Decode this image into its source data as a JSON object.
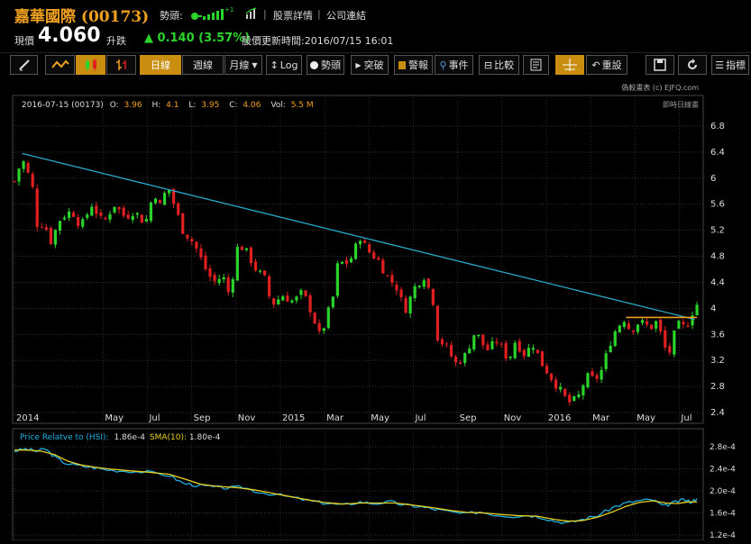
{
  "header": {
    "stock_name": "嘉華國際 (00173)",
    "trend_label": "勢頭:",
    "links": [
      "股票詳情",
      "公司連結"
    ],
    "current_label": "現價",
    "price": "4.060",
    "change_label": "升跌",
    "change": "0.140 (3.57%)",
    "update_label": "股價更新時間:",
    "update_time": "2016/07/15 16:01",
    "signal_text": "+1"
  },
  "toolbar": {
    "daily": "日線",
    "weekly": "週線",
    "monthly": "月線",
    "log": "Log",
    "trend": "勢頭",
    "breakout": "突破",
    "alert": "警報",
    "events": "事件",
    "compare": "比較",
    "reset": "重設",
    "indicators": "指標"
  },
  "colors": {
    "up": "#2bd42b",
    "down": "#e02020",
    "trendline": "#2aa8c8",
    "resistance": "#f0a020",
    "rs_line": "#20b0e0",
    "sma_line": "#e8d020",
    "label_orange": "#f0a020"
  },
  "chart_data": [
    {
      "type": "candlestick",
      "info": {
        "date": "2016-07-15 (00173)",
        "o_label": "O:",
        "o": "3.96",
        "h_label": "H:",
        "h": "4.1",
        "l_label": "L:",
        "l": "3.95",
        "c_label": "C:",
        "c": "4.06",
        "vol_label": "Vol:",
        "vol": "5.5 M"
      },
      "copyright": "偽較畫表 (c) EJFQ.com",
      "sub_label": "即時日線畫",
      "y_ticks": [
        "6.8",
        "6.4",
        "6",
        "5.6",
        "5.2",
        "4.8",
        "4.4",
        "4",
        "3.6",
        "3.2",
        "2.8",
        "2.4"
      ],
      "ylim": [
        2.4,
        6.8
      ],
      "x_ticks": [
        "2014",
        "May",
        "Jul",
        "Sep",
        "Nov",
        "2015",
        "Mar",
        "May",
        "Jul",
        "Sep",
        "Nov",
        "2016",
        "Mar",
        "May",
        "Jul"
      ],
      "x_tick_months": [
        0,
        4,
        6,
        8,
        10,
        12,
        14,
        16,
        18,
        20,
        22,
        24,
        26,
        28,
        30
      ],
      "x_range_months": [
        0,
        31.0
      ],
      "close_anchors": [
        [
          0,
          5.95
        ],
        [
          0.35,
          6.3
        ],
        [
          0.8,
          5.9
        ],
        [
          1.1,
          5.1
        ],
        [
          1.3,
          5.4
        ],
        [
          1.6,
          5.0
        ],
        [
          2.1,
          5.4
        ],
        [
          2.6,
          5.5
        ],
        [
          3.0,
          5.25
        ],
        [
          3.5,
          5.6
        ],
        [
          4.0,
          5.3
        ],
        [
          4.5,
          5.6
        ],
        [
          5.0,
          5.4
        ],
        [
          5.4,
          5.5
        ],
        [
          5.9,
          5.3
        ],
        [
          6.3,
          5.8
        ],
        [
          6.6,
          5.55
        ],
        [
          6.9,
          5.9
        ],
        [
          7.3,
          5.5
        ],
        [
          7.6,
          5.2
        ],
        [
          8.1,
          5.0
        ],
        [
          8.7,
          4.55
        ],
        [
          9.0,
          4.4
        ],
        [
          9.4,
          4.5
        ],
        [
          9.7,
          4.2
        ],
        [
          10.1,
          5.0
        ],
        [
          10.5,
          4.85
        ],
        [
          10.9,
          4.6
        ],
        [
          11.3,
          4.45
        ],
        [
          11.6,
          4.05
        ],
        [
          12.1,
          4.2
        ],
        [
          12.6,
          4.1
        ],
        [
          13.0,
          4.25
        ],
        [
          13.4,
          3.95
        ],
        [
          13.8,
          3.55
        ],
        [
          14.4,
          4.2
        ],
        [
          14.6,
          4.7
        ],
        [
          15.1,
          4.7
        ],
        [
          15.6,
          5.1
        ],
        [
          15.9,
          4.9
        ],
        [
          16.4,
          4.75
        ],
        [
          16.8,
          4.5
        ],
        [
          17.3,
          4.3
        ],
        [
          17.6,
          3.95
        ],
        [
          18.1,
          4.35
        ],
        [
          18.5,
          4.5
        ],
        [
          18.9,
          4.1
        ],
        [
          19.1,
          3.55
        ],
        [
          19.5,
          3.4
        ],
        [
          19.9,
          3.15
        ],
        [
          20.3,
          3.25
        ],
        [
          20.8,
          3.65
        ],
        [
          21.3,
          3.35
        ],
        [
          21.8,
          3.5
        ],
        [
          22.3,
          3.2
        ],
        [
          22.6,
          3.5
        ],
        [
          23.0,
          3.3
        ],
        [
          23.4,
          3.45
        ],
        [
          23.8,
          3.15
        ],
        [
          24.1,
          3.0
        ],
        [
          24.6,
          2.75
        ],
        [
          25.0,
          2.55
        ],
        [
          25.4,
          2.6
        ],
        [
          25.8,
          2.95
        ],
        [
          26.2,
          2.9
        ],
        [
          26.5,
          3.05
        ],
        [
          27.0,
          3.6
        ],
        [
          27.5,
          3.85
        ],
        [
          27.8,
          3.65
        ],
        [
          28.2,
          3.8
        ],
        [
          28.7,
          3.7
        ],
        [
          29.0,
          3.8
        ],
        [
          29.3,
          3.45
        ],
        [
          29.5,
          3.25
        ],
        [
          29.9,
          3.75
        ],
        [
          30.3,
          3.7
        ],
        [
          30.6,
          3.95
        ],
        [
          30.8,
          4.06
        ]
      ],
      "trendline": [
        [
          0.35,
          6.38
        ],
        [
          30.7,
          3.83
        ]
      ],
      "resistance": [
        [
          27.6,
          3.86
        ],
        [
          30.8,
          3.86
        ]
      ]
    },
    {
      "type": "line",
      "legend": [
        {
          "label": "Price Relatve to (HSI):",
          "value": "1.86e-4"
        },
        {
          "label": "SMA(10):",
          "value": "1.80e-4"
        }
      ],
      "y_ticks": [
        "2.8e-4",
        "2.4e-4",
        "2.0e-4",
        "1.6e-4",
        "1.2e-4"
      ],
      "ylim": [
        1.2,
        2.8
      ],
      "series": [
        {
          "key": "rs",
          "values": [
            [
              0,
              2.72
            ],
            [
              0.5,
              2.76
            ],
            [
              1.0,
              2.72
            ],
            [
              1.4,
              2.76
            ],
            [
              1.8,
              2.62
            ],
            [
              2.3,
              2.5
            ],
            [
              3.0,
              2.45
            ],
            [
              3.6,
              2.42
            ],
            [
              4.2,
              2.38
            ],
            [
              5.0,
              2.36
            ],
            [
              6.0,
              2.34
            ],
            [
              7.0,
              2.28
            ],
            [
              7.6,
              2.14
            ],
            [
              8.2,
              2.1
            ],
            [
              9.0,
              2.07
            ],
            [
              9.6,
              2.05
            ],
            [
              10.3,
              2.07
            ],
            [
              11.0,
              1.98
            ],
            [
              12.0,
              1.92
            ],
            [
              12.8,
              1.86
            ],
            [
              13.6,
              1.8
            ],
            [
              14.2,
              1.77
            ],
            [
              14.8,
              1.74
            ],
            [
              15.6,
              1.8
            ],
            [
              16.2,
              1.77
            ],
            [
              17.0,
              1.8
            ],
            [
              17.6,
              1.74
            ],
            [
              18.2,
              1.72
            ],
            [
              18.8,
              1.68
            ],
            [
              19.5,
              1.63
            ],
            [
              20.3,
              1.58
            ],
            [
              21.0,
              1.62
            ],
            [
              21.8,
              1.56
            ],
            [
              22.5,
              1.54
            ],
            [
              23.2,
              1.56
            ],
            [
              23.8,
              1.52
            ],
            [
              24.4,
              1.45
            ],
            [
              25.0,
              1.42
            ],
            [
              25.6,
              1.48
            ],
            [
              26.3,
              1.55
            ],
            [
              27.0,
              1.7
            ],
            [
              27.6,
              1.78
            ],
            [
              28.2,
              1.82
            ],
            [
              28.8,
              1.84
            ],
            [
              29.3,
              1.72
            ],
            [
              29.7,
              1.78
            ],
            [
              30.2,
              1.84
            ],
            [
              30.5,
              1.8
            ],
            [
              30.8,
              1.86
            ]
          ]
        },
        {
          "key": "sma",
          "values": [
            [
              0,
              2.74
            ],
            [
              0.6,
              2.74
            ],
            [
              1.2,
              2.72
            ],
            [
              1.8,
              2.66
            ],
            [
              2.4,
              2.54
            ],
            [
              3.0,
              2.47
            ],
            [
              3.6,
              2.43
            ],
            [
              4.2,
              2.4
            ],
            [
              5.0,
              2.37
            ],
            [
              6.0,
              2.34
            ],
            [
              7.0,
              2.3
            ],
            [
              7.8,
              2.2
            ],
            [
              8.4,
              2.12
            ],
            [
              9.2,
              2.08
            ],
            [
              10.0,
              2.06
            ],
            [
              10.8,
              2.02
            ],
            [
              11.6,
              1.96
            ],
            [
              12.4,
              1.9
            ],
            [
              13.2,
              1.84
            ],
            [
              14.0,
              1.79
            ],
            [
              14.8,
              1.76
            ],
            [
              15.6,
              1.78
            ],
            [
              16.4,
              1.78
            ],
            [
              17.2,
              1.78
            ],
            [
              18.0,
              1.74
            ],
            [
              18.8,
              1.7
            ],
            [
              19.6,
              1.65
            ],
            [
              20.4,
              1.61
            ],
            [
              21.2,
              1.6
            ],
            [
              22.0,
              1.57
            ],
            [
              22.8,
              1.55
            ],
            [
              23.6,
              1.54
            ],
            [
              24.4,
              1.48
            ],
            [
              25.0,
              1.45
            ],
            [
              25.6,
              1.46
            ],
            [
              26.3,
              1.52
            ],
            [
              27.0,
              1.62
            ],
            [
              27.6,
              1.72
            ],
            [
              28.2,
              1.79
            ],
            [
              28.8,
              1.82
            ],
            [
              29.4,
              1.78
            ],
            [
              29.9,
              1.77
            ],
            [
              30.4,
              1.8
            ],
            [
              30.8,
              1.8
            ]
          ]
        }
      ]
    }
  ]
}
